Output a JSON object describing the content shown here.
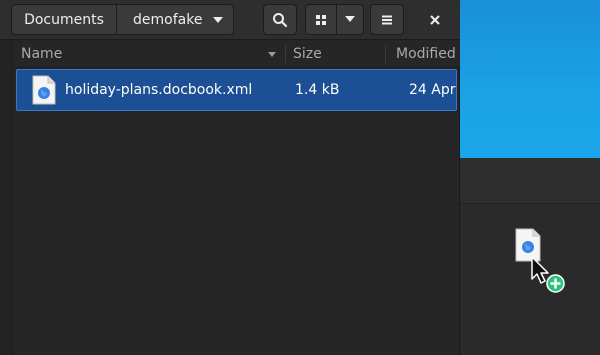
{
  "headerbar": {
    "breadcrumbs": [
      {
        "label": "Documents"
      },
      {
        "label": "demofake"
      }
    ]
  },
  "list": {
    "columns": [
      {
        "label": "Name"
      },
      {
        "label": "Size"
      },
      {
        "label": "Modified"
      }
    ],
    "rows": [
      {
        "name": "holiday-plans.docbook.xml",
        "size": "1.4 kB",
        "modified": "24 Apr",
        "icon": "xml-document-icon"
      }
    ]
  },
  "colors": {
    "selection": "#1c4f93",
    "accent_blue": "#1aa3e6",
    "drop_badge": "#2ec27e"
  }
}
